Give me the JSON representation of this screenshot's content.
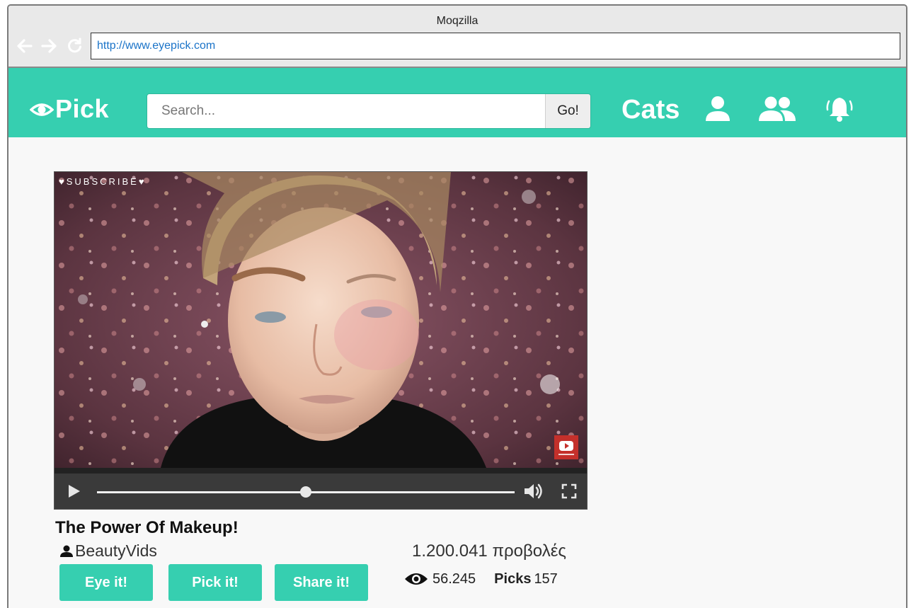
{
  "browser": {
    "window_title": "Moqzilla",
    "url": "http://www.eyepick.com",
    "nav": {
      "back_icon": "arrow-left-icon",
      "forward_icon": "arrow-right-icon",
      "reload_icon": "reload-icon"
    }
  },
  "header": {
    "logo_text": "Pick",
    "search": {
      "placeholder": "Search...",
      "value": "",
      "button_label": "Go!"
    },
    "cats_label": "Cats",
    "icons": [
      "user-icon",
      "users-icon",
      "bell-icon"
    ],
    "accent_color": "#36cfb0"
  },
  "video": {
    "overlay_text": "♥SUBSCRIBE♥",
    "title": "The Power Of Makeup!",
    "channel": "BeautyVids",
    "views_text": "1.200.041 προβολές",
    "progress": 0.5,
    "actions": {
      "eye_label": "Eye it!",
      "pick_label": "Pick it!",
      "share_label": "Share it!"
    },
    "stats": {
      "eyes": "56.245",
      "picks_label": "Picks",
      "picks": "157"
    }
  }
}
